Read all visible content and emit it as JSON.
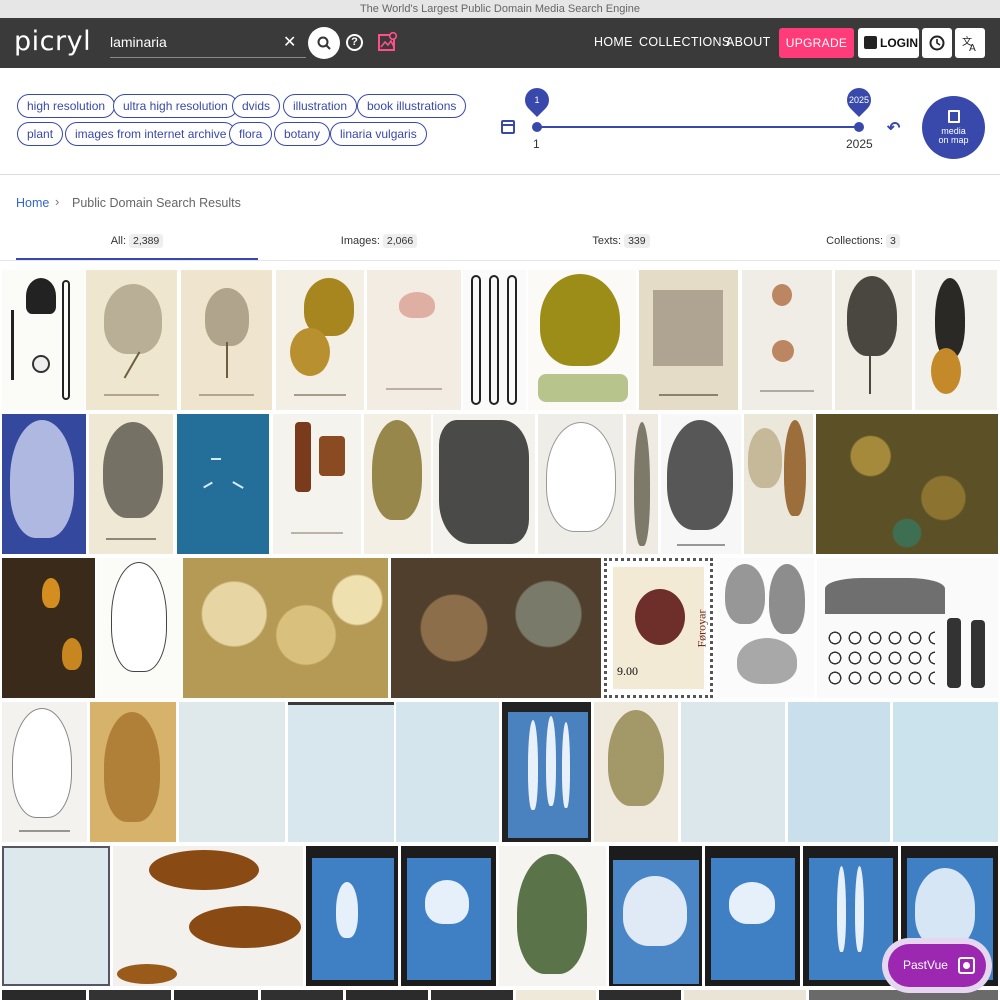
{
  "banner": {
    "text": "The World's Largest Public Domain Media Search Engine"
  },
  "header": {
    "logo": "picryl",
    "search_value": "laminaria",
    "clear_glyph": "✕",
    "help_glyph": "?",
    "nav": [
      "HOME",
      "COLLECTIONS",
      "ABOUT"
    ],
    "upgrade": "UPGRADE",
    "login": "LOGIN",
    "accent": "#ff3b7a"
  },
  "chips": [
    "high resolution",
    "ultra high resolution",
    "dvids",
    "illustration",
    "book illustrations",
    "plant",
    "images from internet archive",
    "flora",
    "botany",
    "linaria vulgaris"
  ],
  "date_range": {
    "min_pin": "1",
    "max_pin": "2025",
    "min_label": "1",
    "max_label": "2025"
  },
  "map_button": {
    "line1": "media",
    "line2": "on map"
  },
  "breadcrumb": {
    "home": "Home",
    "sep": "›",
    "current": "Public Domain Search Results"
  },
  "tabs": [
    {
      "label": "All:",
      "count": "2,389"
    },
    {
      "label": "Images:",
      "count": "2,066"
    },
    {
      "label": "Texts:",
      "count": "339"
    },
    {
      "label": "Collections:",
      "count": "3"
    }
  ],
  "pastvue": {
    "label": "PastVue"
  },
  "colors": {
    "primary": "#3949ab",
    "navbar": "#3a3a3a",
    "pastvue": "#9c27b0"
  },
  "stamp": {
    "country": "Føroyar",
    "value": "9.00"
  }
}
